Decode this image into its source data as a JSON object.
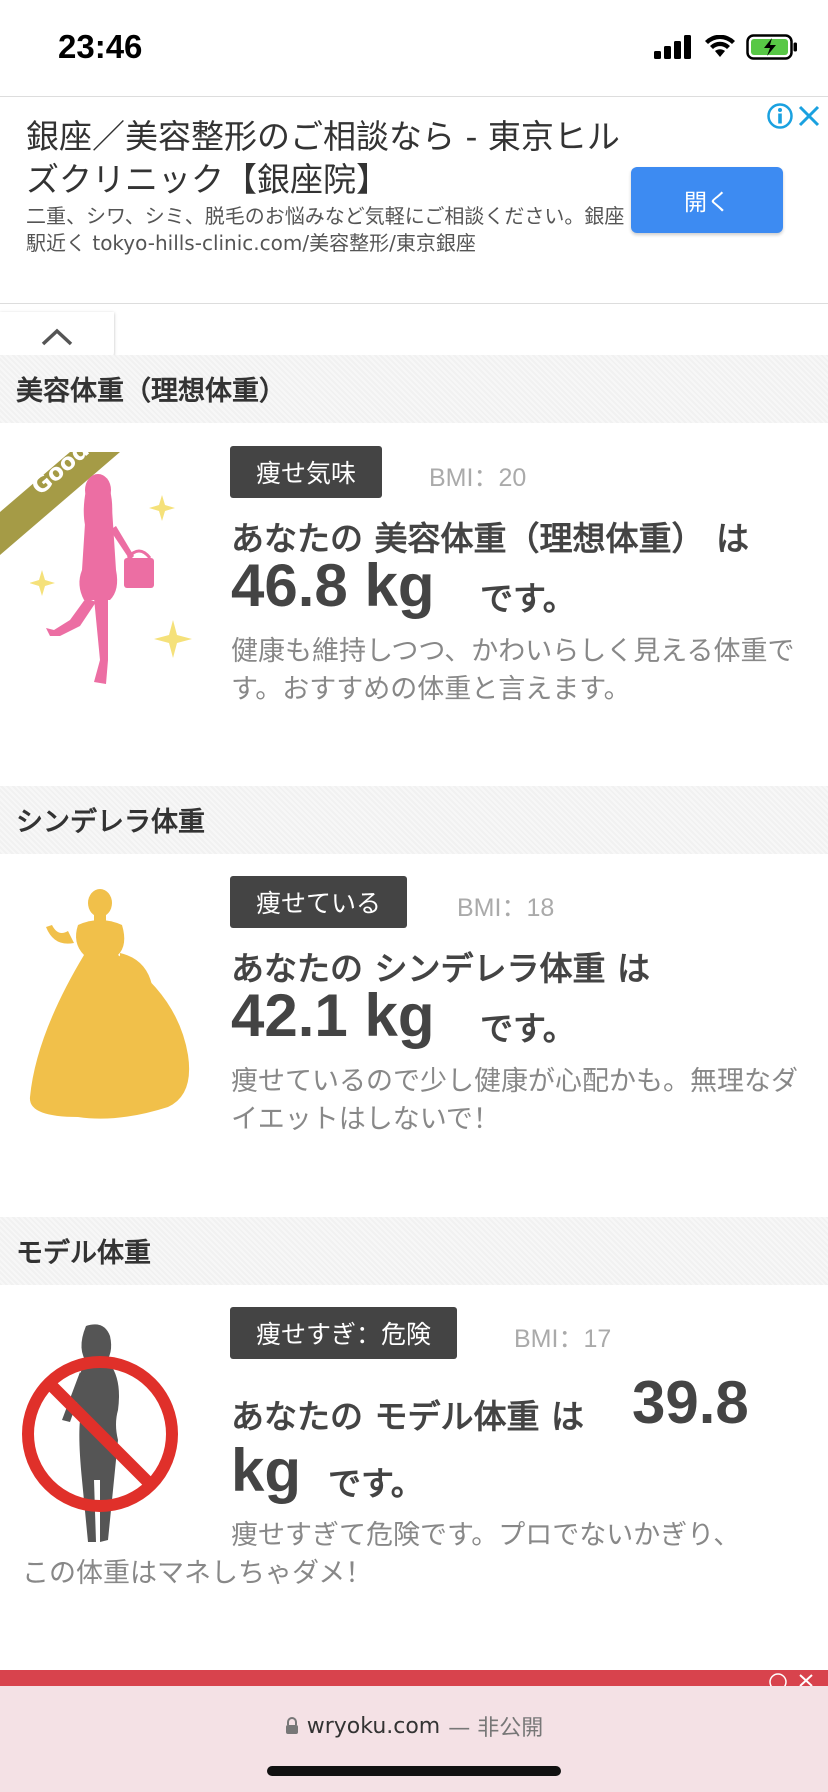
{
  "status": {
    "time": "23:46"
  },
  "ad": {
    "title": "銀座／美容整形のご相談なら - 東京ヒルズクリニック【銀座院】",
    "description": "二重、シワ、シミ、脱毛のお悩みなど気軽にご相談ください。銀座駅近く tokyo-hills-clinic.com/美容整形/東京銀座",
    "button_label": "開く",
    "button_color": "#3d8bf2"
  },
  "sections": [
    {
      "header": "美容体重（理想体重）",
      "badge": "痩せ気味",
      "bmi": "BMI：20",
      "line": "あなたの 美容体重（理想体重） は",
      "weight": "46.8 kg",
      "suffix": "です。",
      "description": "健康も維持しつつ、かわいらしく見える体重です。おすすめの体重と言えます。",
      "ribbon": "Good!",
      "figure_color": "#ec6ea3"
    },
    {
      "header": "シンデレラ体重",
      "badge": "痩せている",
      "bmi": "BMI：18",
      "line": "あなたの シンデレラ体重 は",
      "weight": "42.1 kg",
      "suffix": "です。",
      "description": "痩せているので少し健康が心配かも。無理なダイエットはしないで！",
      "figure_color": "#f1c04a"
    },
    {
      "header": "モデル体重",
      "badge": "痩せすぎ：危険",
      "bmi": "BMI：17",
      "line": "あなたの モデル体重 は",
      "weight_number": "39.8",
      "weight_unit": "kg",
      "suffix": "です。",
      "description_line1": "痩せすぎて危険です。プロでないかぎり、",
      "description_line2": "この体重はマネしちゃダメ！",
      "figure_color": "#555555",
      "prohibit_color": "#e0302a"
    }
  ],
  "browser": {
    "url": "wryoku.com",
    "url_suffix": "— 非公開",
    "bar_color": "#f4e1e5"
  }
}
